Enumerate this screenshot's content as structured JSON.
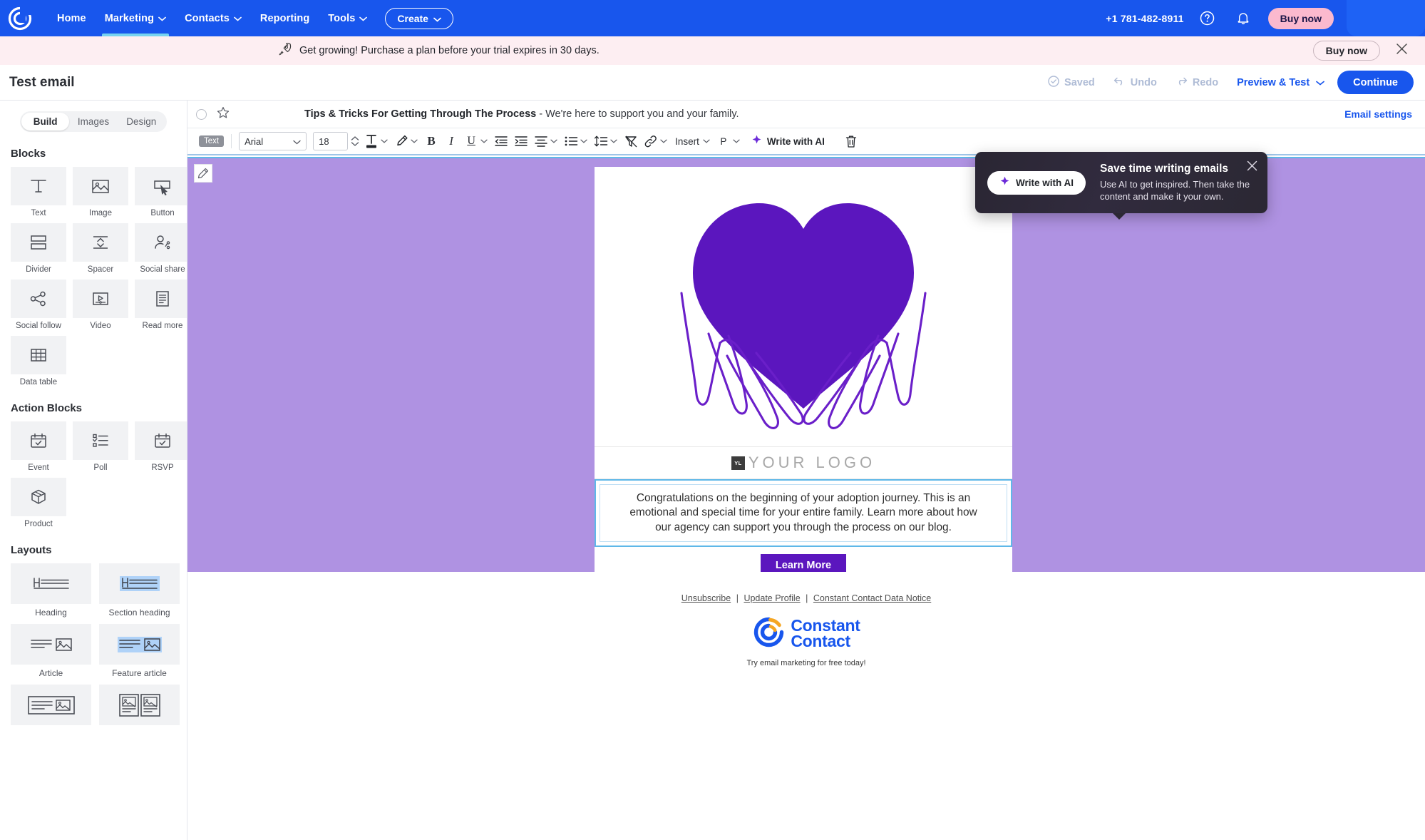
{
  "topnav": {
    "logo": "constant-contact-logo",
    "items": [
      {
        "label": "Home",
        "caret": false,
        "active": false
      },
      {
        "label": "Marketing",
        "caret": true,
        "active": true
      },
      {
        "label": "Contacts",
        "caret": true,
        "active": false
      },
      {
        "label": "Reporting",
        "caret": false,
        "active": false
      },
      {
        "label": "Tools",
        "caret": true,
        "active": false
      }
    ],
    "create_label": "Create",
    "phone": "+1 781-482-8911",
    "help_icon": "help-circle-icon",
    "bell_icon": "bell-icon",
    "buy_now_label": "Buy now",
    "accent": "#1856ED",
    "active_underline": "#76D3F0",
    "buy_now_bg": "#FBB9CE"
  },
  "banner": {
    "icon": "rocket-icon",
    "text": "Get growing! Purchase a plan before your trial expires in 30 days.",
    "buy_now_label": "Buy now",
    "close_icon": "close-icon",
    "bg": "#FDEEF2"
  },
  "pagehead": {
    "title": "Test email",
    "saved_label": "Saved",
    "saved_icon": "check-circle-icon",
    "undo_label": "Undo",
    "undo_icon": "undo-arrow-icon",
    "redo_label": "Redo",
    "redo_icon": "redo-arrow-icon",
    "preview_label": "Preview & Test",
    "continue_label": "Continue"
  },
  "sidebar": {
    "tabs": [
      {
        "label": "Build",
        "active": true
      },
      {
        "label": "Images",
        "active": false
      },
      {
        "label": "Design",
        "active": false
      }
    ],
    "blocks_title": "Blocks",
    "blocks": [
      {
        "label": "Text",
        "icon": "text-block-icon"
      },
      {
        "label": "Image",
        "icon": "image-block-icon"
      },
      {
        "label": "Button",
        "icon": "button-block-icon"
      },
      {
        "label": "Divider",
        "icon": "divider-block-icon"
      },
      {
        "label": "Spacer",
        "icon": "spacer-block-icon"
      },
      {
        "label": "Social share",
        "icon": "social-share-icon"
      },
      {
        "label": "Social follow",
        "icon": "social-follow-icon"
      },
      {
        "label": "Video",
        "icon": "video-block-icon"
      },
      {
        "label": "Read more",
        "icon": "read-more-icon"
      },
      {
        "label": "Data table",
        "icon": "data-table-icon"
      }
    ],
    "action_blocks_title": "Action Blocks",
    "action_blocks": [
      {
        "label": "Event",
        "icon": "event-calendar-icon"
      },
      {
        "label": "Poll",
        "icon": "poll-list-icon"
      },
      {
        "label": "RSVP",
        "icon": "rsvp-calendar-icon"
      },
      {
        "label": "Product",
        "icon": "product-box-icon"
      }
    ],
    "layouts_title": "Layouts",
    "layouts": [
      {
        "label": "Heading",
        "icon": "heading-layout-icon"
      },
      {
        "label": "Section heading",
        "icon": "section-heading-layout-icon"
      },
      {
        "label": "Article",
        "icon": "article-layout-icon"
      },
      {
        "label": "Feature article",
        "icon": "feature-article-layout-icon"
      },
      {
        "label": "",
        "icon": "boxed-article-layout-icon"
      },
      {
        "label": "",
        "icon": "two-column-article-layout-icon"
      }
    ]
  },
  "subject_bar": {
    "select_icon": "selection-circle-icon",
    "star_icon": "star-icon",
    "subject": "Tips & Tricks For Getting Through The Process",
    "preheader": "- We're here to support you and your family.",
    "email_settings_label": "Email settings"
  },
  "toolbar": {
    "text_chip": "Text",
    "font_family": "Arial",
    "font_size": "18",
    "paragraph_label": "P",
    "insert_label": "Insert",
    "ai_label": "Write with AI",
    "icons": [
      "font-color-icon",
      "highlight-color-icon",
      "bold-icon",
      "italic-icon",
      "underline-icon",
      "decrease-indent-icon",
      "increase-indent-icon",
      "align-icon",
      "bullet-list-icon",
      "line-spacing-icon",
      "clear-formatting-icon",
      "link-icon",
      "delete-icon"
    ]
  },
  "canvas": {
    "pencil_icon": "pencil-edit-icon",
    "background": "#AF92E2",
    "hero_image": "purple-heart-in-hands-illustration",
    "hero_color": "#5B16BE",
    "logo_badge": "YL",
    "logo_text": "YOUR LOGO",
    "body_text": "Congratulations on the beginning of your adoption journey. This is an emotional and special time for your entire family. Learn more about how our agency can support you through the process on our blog.",
    "cta_label": "Learn More",
    "cta_color": "#5B16BE",
    "social": [
      {
        "name": "facebook-icon",
        "color": "#3B5998"
      },
      {
        "name": "x-twitter-icon",
        "color": "#0B0B0B"
      },
      {
        "name": "instagram-icon",
        "color": "#E1306C"
      }
    ]
  },
  "footer": {
    "links": [
      "Unsubscribe",
      "Update Profile",
      "Constant Contact Data Notice"
    ],
    "separator": "|",
    "logo_line1": "Constant",
    "logo_line2": "Contact",
    "tagline": "Try email marketing for free today!"
  },
  "ai_popover": {
    "button_label": "Write with AI",
    "title": "Save time writing emails",
    "body": "Use AI to get inspired. Then take the content and make it your own.",
    "close_icon": "close-icon",
    "spark_icon": "ai-sparkle-icon"
  }
}
